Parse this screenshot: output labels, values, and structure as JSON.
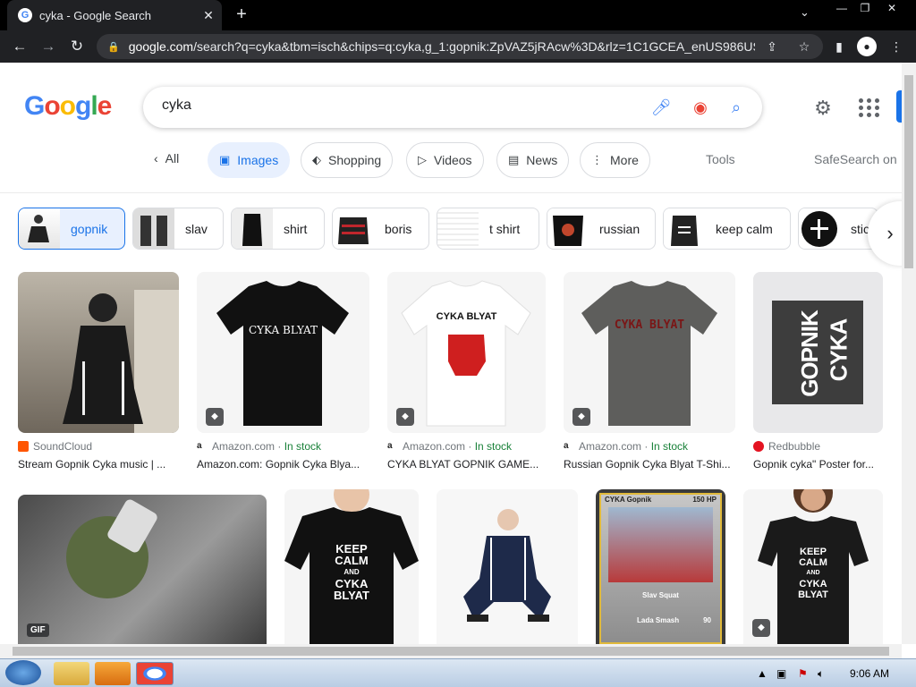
{
  "browser": {
    "tab_title": "cyka - Google Search",
    "url_domain": "google.com",
    "url_rest": "/search?q=cyka&tbm=isch&chips=q:cyka,g_1:gopnik:ZpVAZ5jRAcw%3D&rlz=1C1GCEA_enUS986US..."
  },
  "search": {
    "logo": [
      "G",
      "o",
      "o",
      "g",
      "l",
      "e"
    ],
    "query": "cyka"
  },
  "nav": {
    "all": "All",
    "tabs": [
      {
        "label": "Images",
        "icon": "image-icon"
      },
      {
        "label": "Shopping",
        "icon": "tag-icon"
      },
      {
        "label": "Videos",
        "icon": "play-icon"
      },
      {
        "label": "News",
        "icon": "news-icon"
      },
      {
        "label": "More",
        "icon": "more-icon"
      }
    ],
    "tools": "Tools",
    "safesearch": "SafeSearch on"
  },
  "chips": [
    "gopnik",
    "slav",
    "shirt",
    "boris",
    "t shirt",
    "russian",
    "keep calm",
    "stic"
  ],
  "results_row1": [
    {
      "source": "SoundCloud",
      "stock": "",
      "title": "Stream Gopnik Cyka music | ...",
      "fav_color": "#ff5500"
    },
    {
      "source": "Amazon.com",
      "stock": "In stock",
      "title": "Amazon.com: Gopnik Cyka Blya...",
      "fav_color": "#222222",
      "shirt_text": "CYKA BLYAT"
    },
    {
      "source": "Amazon.com",
      "stock": "In stock",
      "title": "CYKA BLYAT GOPNIK GAME...",
      "fav_color": "#222222",
      "shirt_text": "CYKA   BLYAT"
    },
    {
      "source": "Amazon.com",
      "stock": "In stock",
      "title": "Russian Gopnik Cyka Blyat T-Shi...",
      "fav_color": "#222222",
      "shirt_text": "CYKA BLYAT"
    },
    {
      "source": "Redbubble",
      "stock": "",
      "title": "Gopnik cyka\" Poster for...",
      "fav_color": "#e41321",
      "poster_1": "GOPNIK",
      "poster_2": "CYKA"
    }
  ],
  "results_row2": {
    "gif_label": "GIF",
    "shirt1": [
      "KEEP",
      "CALM",
      "AND",
      "CYKA",
      "BLYAT"
    ],
    "card_title": "CYKA Gopnik",
    "card_hp": "150 HP",
    "card_move1": "Slav Squat",
    "card_move2": "Lada Smash",
    "card_dmg": "90",
    "shirt2": [
      "KEEP",
      "CALM",
      "AND",
      "CYKA",
      "BLYAT"
    ]
  },
  "taskbar": {
    "time": "9:06 AM"
  }
}
